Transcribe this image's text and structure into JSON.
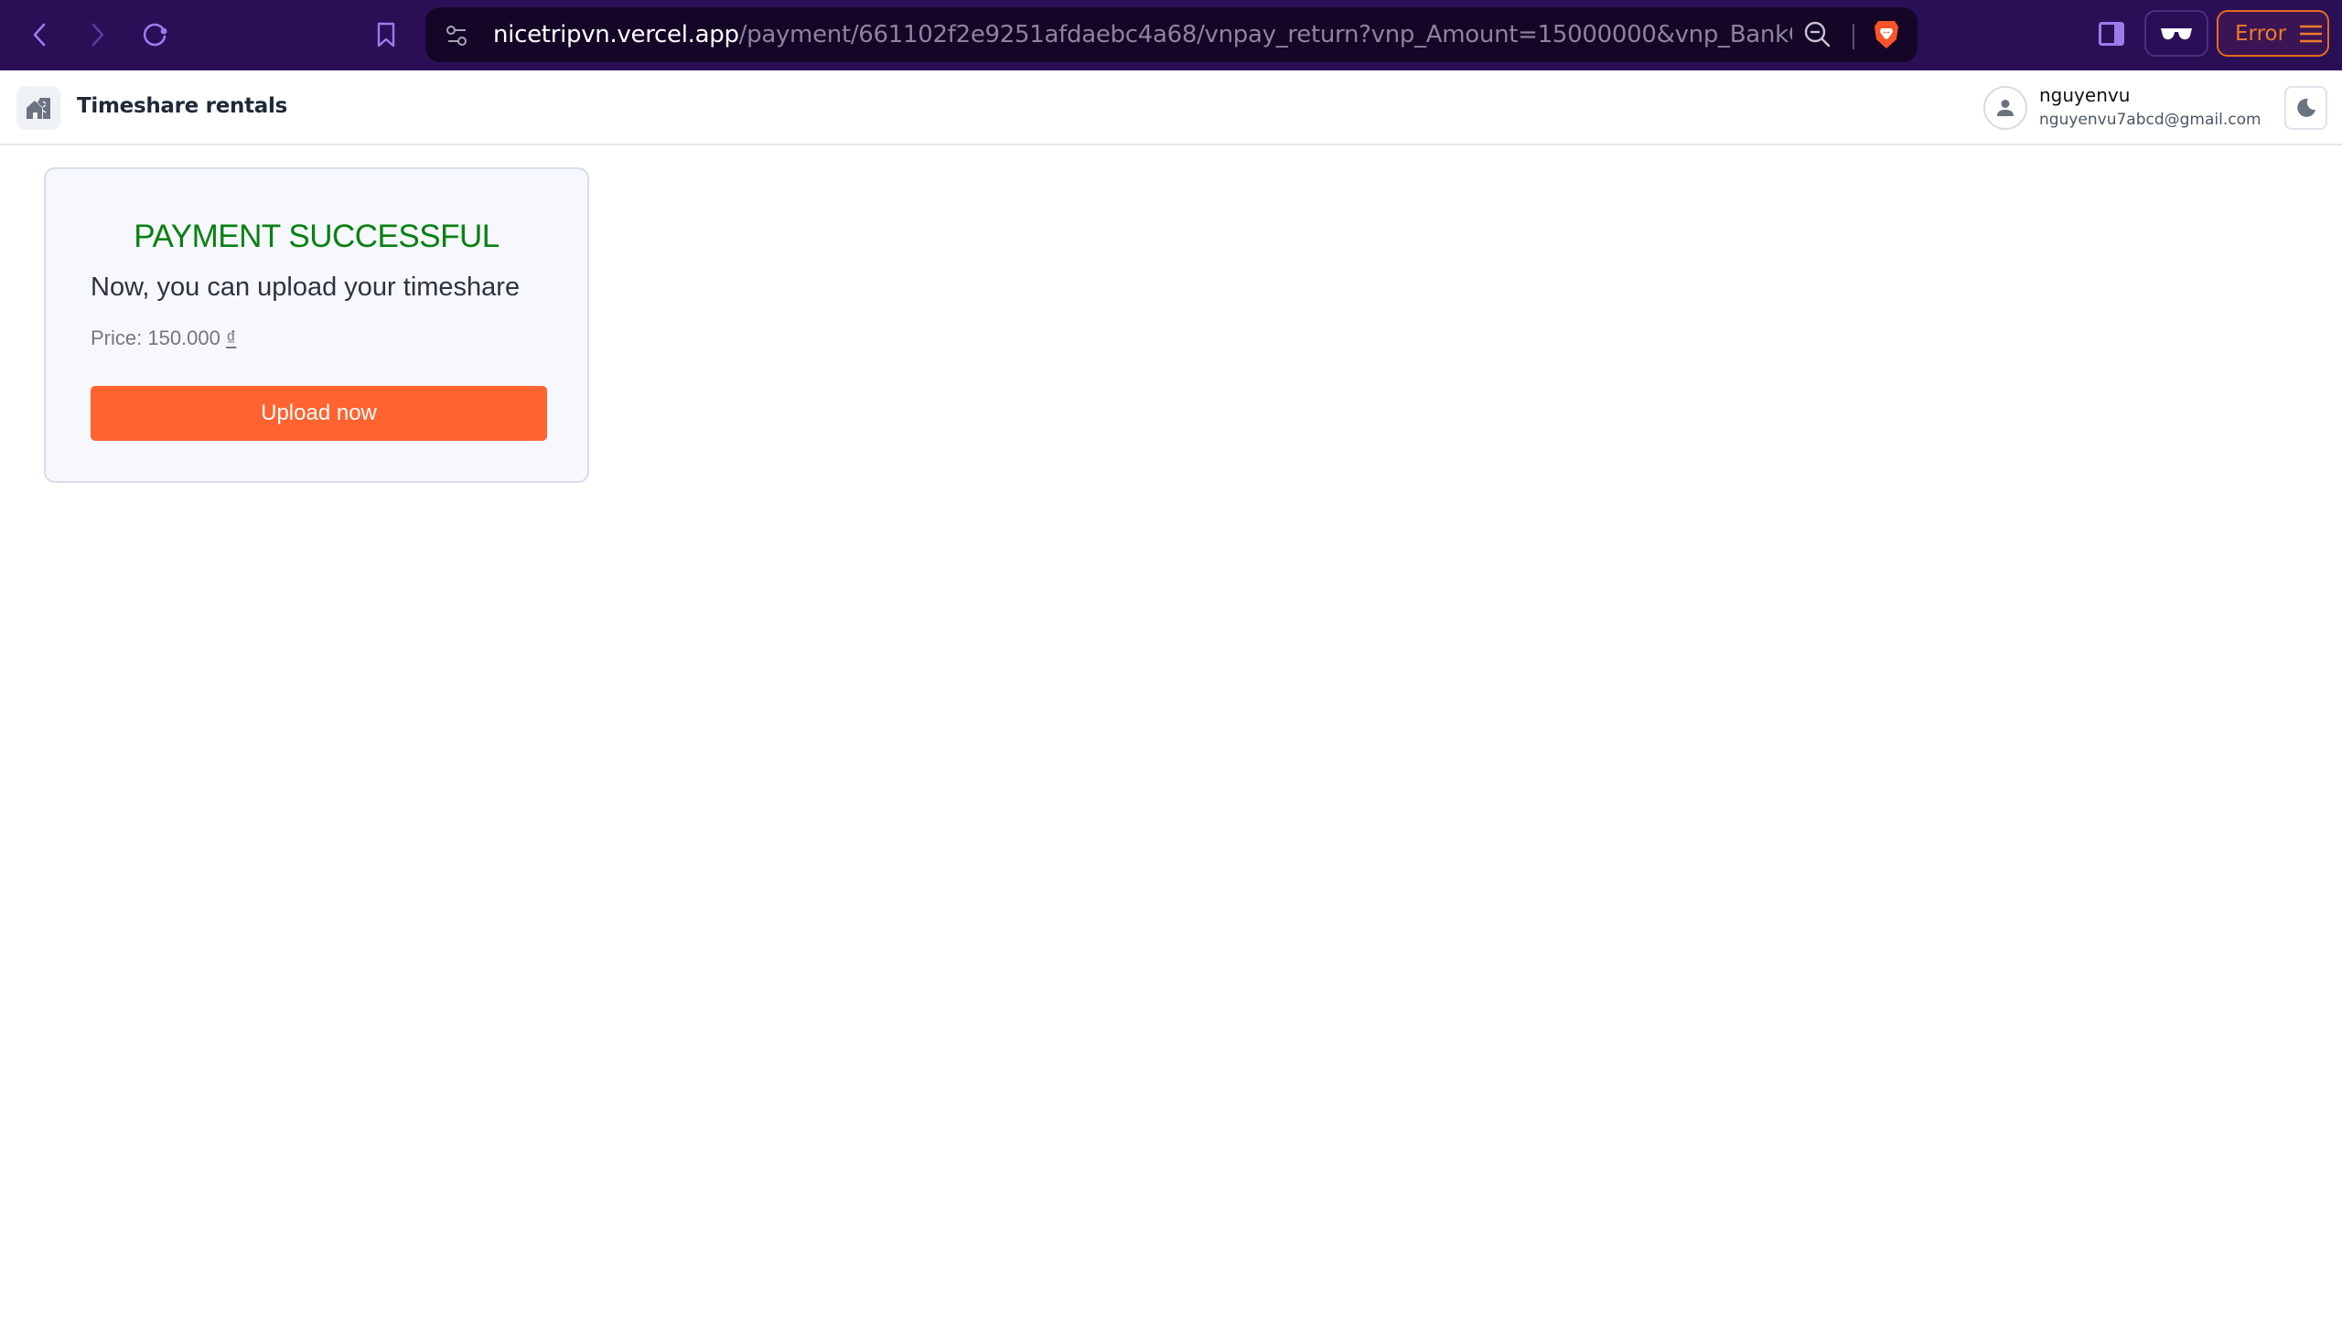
{
  "browser": {
    "url_host": "nicetripvn.vercel.app",
    "url_path": "/payment/661102f2e9251afdaebc4a68/vnpay_return?vnp_Amount=15000000&vnp_BankCode=NC...",
    "error_label": "Error",
    "colors": {
      "chrome_bg": "#2a0f57",
      "icon": "#9f7aea",
      "error": "#f07a2a"
    }
  },
  "header": {
    "brand": "Timeshare rentals",
    "user": {
      "name": "nguyenvu",
      "email": "nguyenvu7abcd@gmail.com"
    }
  },
  "card": {
    "title": "PAYMENT SUCCESSFUL",
    "subtitle": "Now, you can upload your timeshare",
    "price_label": "Price: 150.000",
    "currency": "₫",
    "button_label": "Upload now",
    "colors": {
      "title": "#0a8012",
      "button": "#ff6330"
    }
  }
}
